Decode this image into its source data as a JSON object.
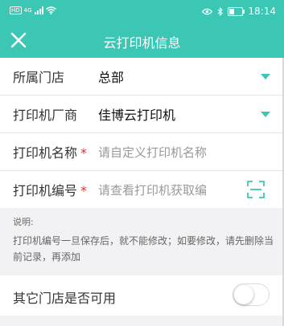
{
  "status_bar": {
    "hd_badge": "HD",
    "network": "4G",
    "time": "18:14",
    "battery_level": 0.45,
    "icons": [
      "signal-icon",
      "wifi-icon",
      "eye-icon",
      "bluetooth-icon",
      "battery-icon"
    ]
  },
  "header": {
    "title": "云打印机信息",
    "close_icon": "close-icon"
  },
  "form": {
    "store": {
      "label": "所属门店",
      "value": "总部"
    },
    "vendor": {
      "label": "打印机厂商",
      "value": "佳博云打印机"
    },
    "name": {
      "label": "打印机名称",
      "required_mark": "*",
      "placeholder": "请自定义打印机名称"
    },
    "code": {
      "label": "打印机编号",
      "required_mark": "*",
      "placeholder": "请查看打印机获取编"
    }
  },
  "note": {
    "title": "说明:",
    "text": "打印机编号一旦保存后，就不能修改；如要修改，请先删除当前记录，再添加"
  },
  "other_stores": {
    "label": "其它门店是否可用",
    "enabled": false
  },
  "colors": {
    "accent": "#3cc7b4",
    "required": "#e0322b"
  }
}
